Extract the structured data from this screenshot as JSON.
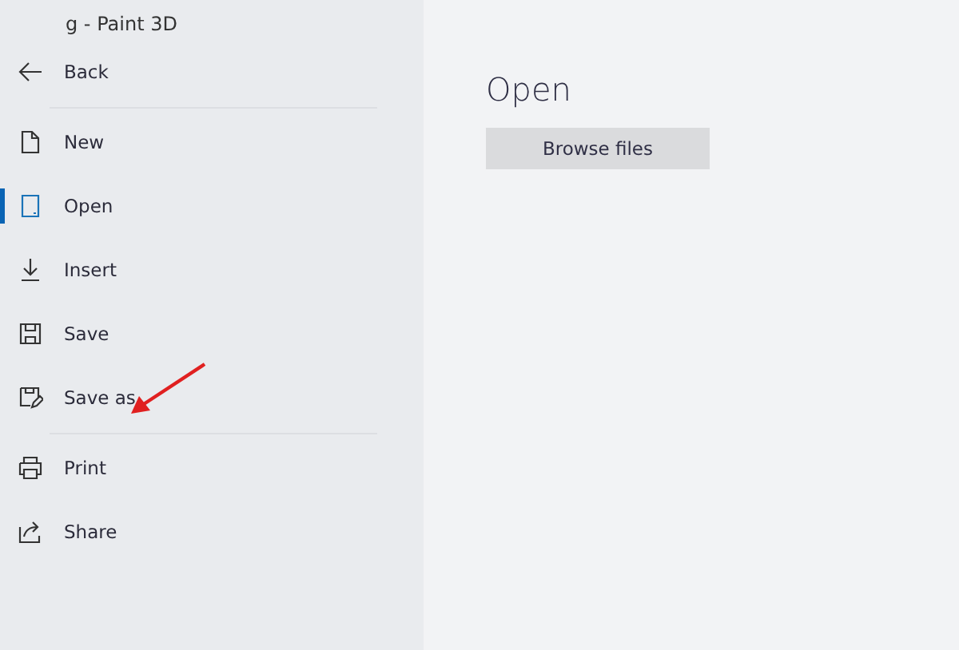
{
  "window": {
    "title": "g - Paint 3D"
  },
  "sidebar": {
    "sections": [
      [
        {
          "kind": "back",
          "label": "Back",
          "selected": false
        }
      ],
      [
        {
          "kind": "new",
          "label": "New",
          "selected": false
        },
        {
          "kind": "open",
          "label": "Open",
          "selected": true
        },
        {
          "kind": "insert",
          "label": "Insert",
          "selected": false
        },
        {
          "kind": "save",
          "label": "Save",
          "selected": false
        },
        {
          "kind": "save_as",
          "label": "Save as",
          "selected": false
        }
      ],
      [
        {
          "kind": "print",
          "label": "Print",
          "selected": false
        },
        {
          "kind": "share",
          "label": "Share",
          "selected": false
        }
      ]
    ]
  },
  "main": {
    "heading": "Open",
    "button": "Browse files"
  }
}
